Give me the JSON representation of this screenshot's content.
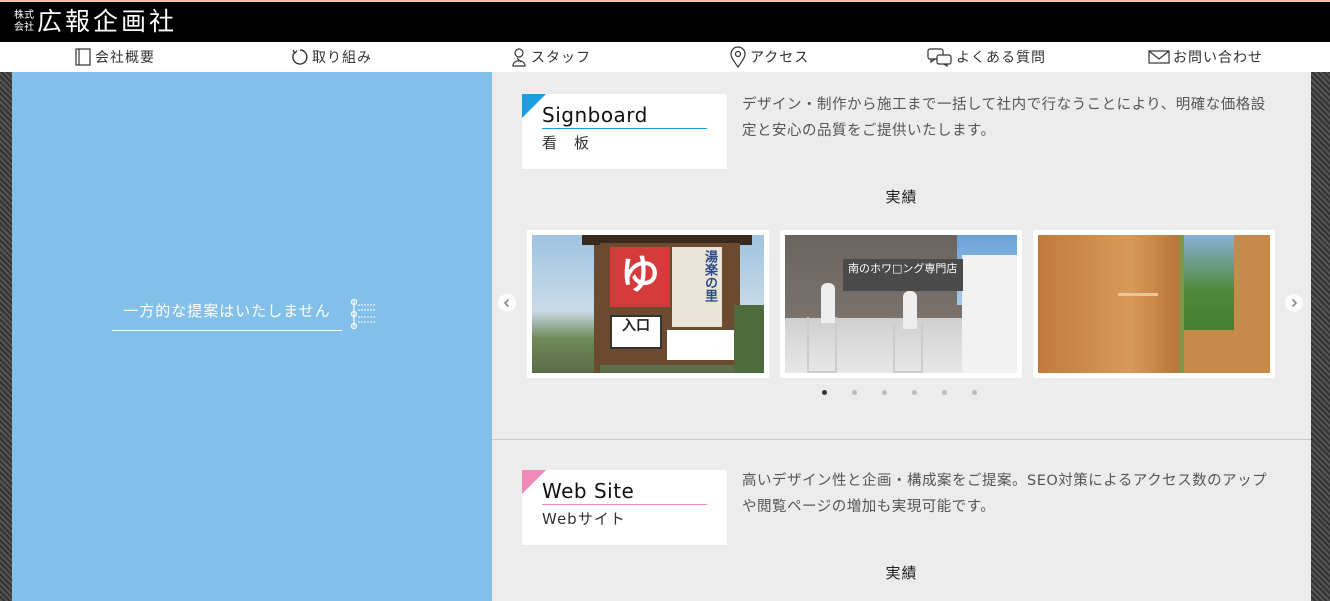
{
  "header": {
    "logo_small_top": "株式",
    "logo_small_bottom": "会社",
    "logo_main": "広報企画社"
  },
  "nav": {
    "items": [
      {
        "label": "会社概要",
        "icon": "notebook-icon"
      },
      {
        "label": "取り組み",
        "icon": "circle-arrow-icon"
      },
      {
        "label": "スタッフ",
        "icon": "person-icon"
      },
      {
        "label": "アクセス",
        "icon": "map-pin-icon"
      },
      {
        "label": "よくある質問",
        "icon": "chat-bubbles-icon"
      },
      {
        "label": "お問い合わせ",
        "icon": "envelope-icon"
      }
    ]
  },
  "hero": {
    "tagline": "一方的な提案はいたしません"
  },
  "sections": [
    {
      "title_en": "Signboard",
      "title_jp": "看　板",
      "accent": "#1a9ee0",
      "description": "デザイン・制作から施工まで一括して社内で行なうことにより、明確な価格設定と安心の品質をご提供いたします。",
      "results_label": "実績",
      "slides": [
        {
          "sign_text": "ゆ",
          "sign_side": "湯楽の里",
          "sign_entrance": "入口"
        },
        {
          "sign_text": "南のホワ□ング専門店"
        },
        {
          "sign_text": ""
        }
      ],
      "dots_count": 6,
      "active_dot": 0
    },
    {
      "title_en": "Web Site",
      "title_jp": "Webサイト",
      "accent": "#f088b8",
      "description": "高いデザイン性と企画・構成案をご提案。SEO対策によるアクセス数のアップや閲覧ページの増加も実現可能です。",
      "results_label": "実績"
    }
  ],
  "colors": {
    "hero_blue": "#82c0ea",
    "panel_gray": "#ececec",
    "header_black": "#000000"
  }
}
